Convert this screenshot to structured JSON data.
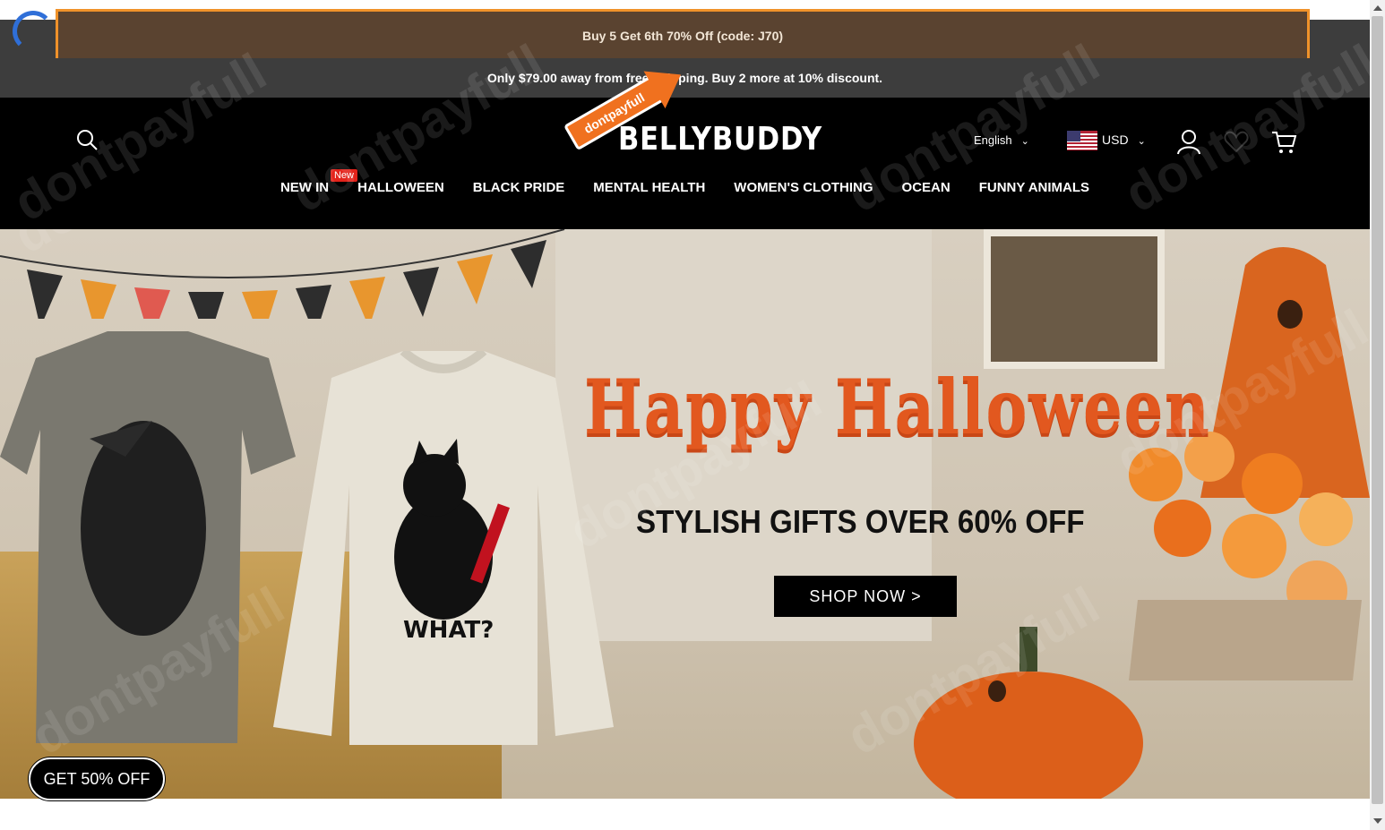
{
  "promo": {
    "text": "Buy 5 Get 6th 70% Off (code: J70)"
  },
  "shipping": {
    "text": "Only $79.00 away from free shipping. Buy 2 more at 10% discount."
  },
  "header": {
    "logo": "BELLYBUDDY",
    "sticker": "dontpayfull",
    "language": "English",
    "currency": "USD"
  },
  "nav": {
    "items": [
      {
        "label": "NEW IN",
        "badge": "New"
      },
      {
        "label": "HALLOWEEN"
      },
      {
        "label": "BLACK PRIDE"
      },
      {
        "label": "MENTAL HEALTH"
      },
      {
        "label": "WOMEN'S CLOTHING"
      },
      {
        "label": "OCEAN"
      },
      {
        "label": "FUNNY ANIMALS"
      }
    ]
  },
  "hero": {
    "title": "Happy Halloween",
    "subtitle": "STYLISH GIFTS OVER 60% OFF",
    "cta": "SHOP NOW >",
    "sweater_print": "WHAT?"
  },
  "coupon": {
    "label": "GET 50% OFF"
  },
  "watermark": "dontpayfull",
  "colors": {
    "promo_border": "#f0922a",
    "accent": "#e2581f",
    "badge": "#e3231b"
  }
}
